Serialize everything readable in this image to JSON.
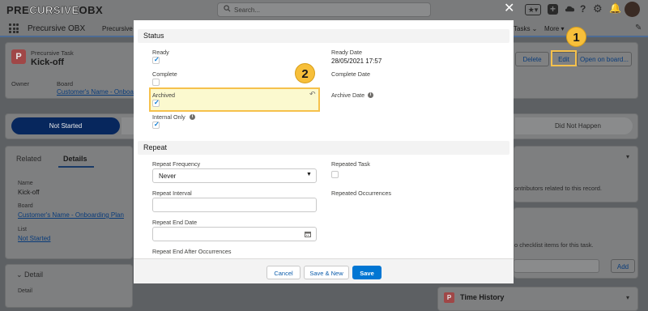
{
  "global": {
    "logo_left": "PRE",
    "logo_mid": "CURSIVE",
    "logo_right": "OBX",
    "search_placeholder": "Search...",
    "app_name": "Precursive OBX",
    "tab_precursive": "Precursive",
    "tab_tasks": "Tasks",
    "tab_more": "More"
  },
  "record": {
    "object_label": "Precursive Task",
    "title": "Kick-off",
    "buttons": {
      "delete": "Delete",
      "edit": "Edit",
      "open_board": "Open on board..."
    },
    "owner_label": "Owner",
    "board_label": "Board",
    "board_value": "Customer's Name - Onboarding Plan",
    "path": {
      "active": "Not Started",
      "last": "Did Not Happen"
    },
    "tabs": {
      "related": "Related",
      "details": "Details"
    },
    "details": {
      "name_label": "Name",
      "name_value": "Kick-off",
      "board_label": "Board",
      "board_value": "Customer's Name - Onboarding Plan",
      "list_label": "List",
      "list_value": "Not Started"
    },
    "detail_section": "Detail",
    "detail_field": "Detail",
    "right_panel": {
      "contributors_text": "ontributors related to this record.",
      "checklist_text": "o checklist items for this task.",
      "add_button": "Add",
      "time_history": "Time History"
    }
  },
  "modal": {
    "status_section": "Status",
    "ready_label": "Ready",
    "ready_checked": true,
    "ready_date_label": "Ready Date",
    "ready_date_value": "28/05/2021 17:57",
    "complete_label": "Complete",
    "complete_checked": false,
    "complete_date_label": "Complete Date",
    "archived_label": "Archived",
    "archived_checked": true,
    "archive_date_label": "Archive Date",
    "internal_only_label": "Internal Only",
    "internal_only_checked": true,
    "repeat_section": "Repeat",
    "repeat_frequency_label": "Repeat Frequency",
    "repeat_frequency_value": "Never",
    "repeated_task_label": "Repeated Task",
    "repeated_task_checked": false,
    "repeat_interval_label": "Repeat Interval",
    "repeat_interval_value": "",
    "repeated_occurrences_label": "Repeated Occurrences",
    "repeat_end_date_label": "Repeat End Date",
    "repeat_end_date_value": "",
    "repeat_end_after_label": "Repeat End After Occurrences",
    "cancel_button": "Cancel",
    "save_new_button": "Save & New",
    "save_button": "Save"
  },
  "callouts": {
    "one": "1",
    "two": "2"
  },
  "colors": {
    "brand_blue": "#0176d3",
    "highlight_fill": "#fbf9cf",
    "highlight_border": "#f6c14c",
    "path_active": "#07275d"
  }
}
